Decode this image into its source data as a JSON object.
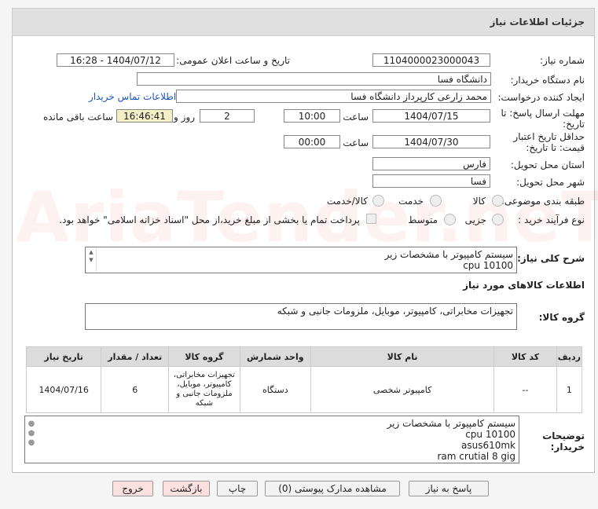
{
  "header": {
    "title": "جزئیات اطلاعات نیاز"
  },
  "form": {
    "need_no_label": "شماره نیاز:",
    "need_no": "1104000023000043",
    "announce_label": "تاریخ و ساعت اعلان عمومی:",
    "announce_value": "1404/07/12 - 16:28",
    "buyer_label": "نام دستگاه خریدار:",
    "buyer": "دانشگاه فسا",
    "creator_label": "ایجاد کننده درخواست:",
    "creator": "محمد زارعی کارپرداز دانشگاه فسا",
    "contact_link": "اطلاعات تماس خریدار",
    "deadline_label_1": "مهلت ارسال پاسخ: تا",
    "deadline_label_2": "تاریخ:",
    "deadline_date": "1404/07/15",
    "time_label": "ساعت",
    "deadline_time": "10:00",
    "days": "2",
    "days_label": "روز و",
    "remaining": "16:46:41",
    "remaining_label": "ساعت باقی مانده",
    "validity_label_1": "حداقل تاریخ اعتبار",
    "validity_label_2": "قیمت: تا تاریخ:",
    "validity_date": "1404/07/30",
    "validity_time": "00:00",
    "province_label": "استان محل تحویل:",
    "province": "فارس",
    "city_label": "شهر محل تحویل:",
    "city": "فسا",
    "category_label": "طبقه بندی موضوعی:",
    "cat_goods": "کالا",
    "cat_service": "خدمت",
    "cat_both": "کالا/خدمت",
    "process_label": "نوع فرآیند خرید :",
    "proc_partial": "جزیی",
    "proc_medium": "متوسط",
    "payment_note": "پرداخت تمام یا بخشی از مبلغ خرید،از محل \"اسناد خزانه اسلامی\" خواهد بود."
  },
  "summary": {
    "label": "شرح کلی نیاز:",
    "lines": [
      "سیستم کامپیوتر با مشخصات زیر",
      "cpu 10100"
    ]
  },
  "goods": {
    "section_title": "اطلاعات کالاهای مورد نیاز",
    "group_label": "گروه کالا:",
    "group_value": "تجهیزات مخابراتی، کامپیوتر، موبایل، ملزومات جانبی و شبکه"
  },
  "table": {
    "headers": [
      "ردیف",
      "کد کالا",
      "نام کالا",
      "واحد شمارش",
      "گروه کالا",
      "تعداد / مقدار",
      "تاریخ نیاز"
    ],
    "rows": [
      {
        "row": "1",
        "code": "--",
        "name": "کامپیوتر شخصی",
        "unit": "دستگاه",
        "group": "تجهیزات مخابراتی، کامپیوتر، موبایل، ملزومات جانبی و شبکه",
        "qty": "6",
        "date": "1404/07/16"
      }
    ]
  },
  "buyer_notes": {
    "label_1": "توضیحات",
    "label_2": "خریدار:",
    "lines": [
      "سیستم کامپیوتر با مشخصات زیر",
      "cpu 10100",
      "asus610mk",
      "ram crutial 8 gig"
    ]
  },
  "buttons": {
    "reply": "پاسخ به نیاز",
    "attachments": "مشاهده مدارک پیوستی (0)",
    "print": "چاپ",
    "back": "بازگشت",
    "exit": "خروج"
  },
  "watermark": "AriaTender.neT"
}
